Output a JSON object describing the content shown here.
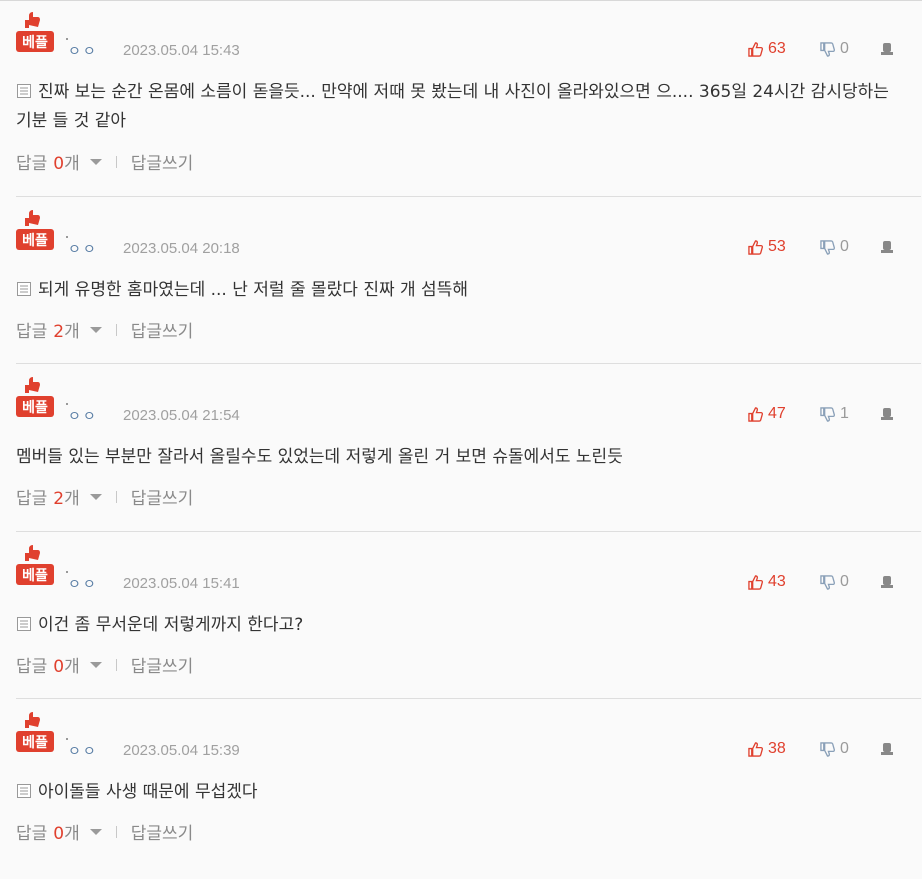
{
  "badge_label": "베플",
  "reply_label": "답글",
  "reply_unit": "개",
  "write_reply_label": "답글쓰기",
  "colors": {
    "accent": "#e0402e",
    "nick": "#5b7fa6",
    "muted": "#a0a0a0"
  },
  "comments": [
    {
      "nick": "ㅇㅇ",
      "date": "2023.05.04 15:43",
      "likes": "63",
      "dislikes": "0",
      "text": "진짜 보는 순간 온몸에 소름이 돋을듯... 만약에 저때 못 봤는데 내 사진이 올라와있으면 으.... 365일 24시간 감시당하는 기분 들 것 같아",
      "has_icon": true,
      "reply_count": "0"
    },
    {
      "nick": "ㅇㅇ",
      "date": "2023.05.04 20:18",
      "likes": "53",
      "dislikes": "0",
      "text": "되게 유명한 홈마였는데 ... 난 저럴 줄 몰랐다 진짜 개 섬뜩해",
      "has_icon": true,
      "reply_count": "2"
    },
    {
      "nick": "ㅇㅇ",
      "date": "2023.05.04 21:54",
      "likes": "47",
      "dislikes": "1",
      "text": "멤버들 있는 부분만 잘라서 올릴수도 있었는데 저렇게 올린 거 보면 슈돌에서도 노린듯",
      "has_icon": false,
      "reply_count": "2"
    },
    {
      "nick": "ㅇㅇ",
      "date": "2023.05.04 15:41",
      "likes": "43",
      "dislikes": "0",
      "text": "이건 좀 무서운데 저렇게까지 한다고?",
      "has_icon": true,
      "reply_count": "0"
    },
    {
      "nick": "ㅇㅇ",
      "date": "2023.05.04 15:39",
      "likes": "38",
      "dislikes": "0",
      "text": "아이돌들 사생 때문에 무섭겠다",
      "has_icon": true,
      "reply_count": "0"
    }
  ]
}
